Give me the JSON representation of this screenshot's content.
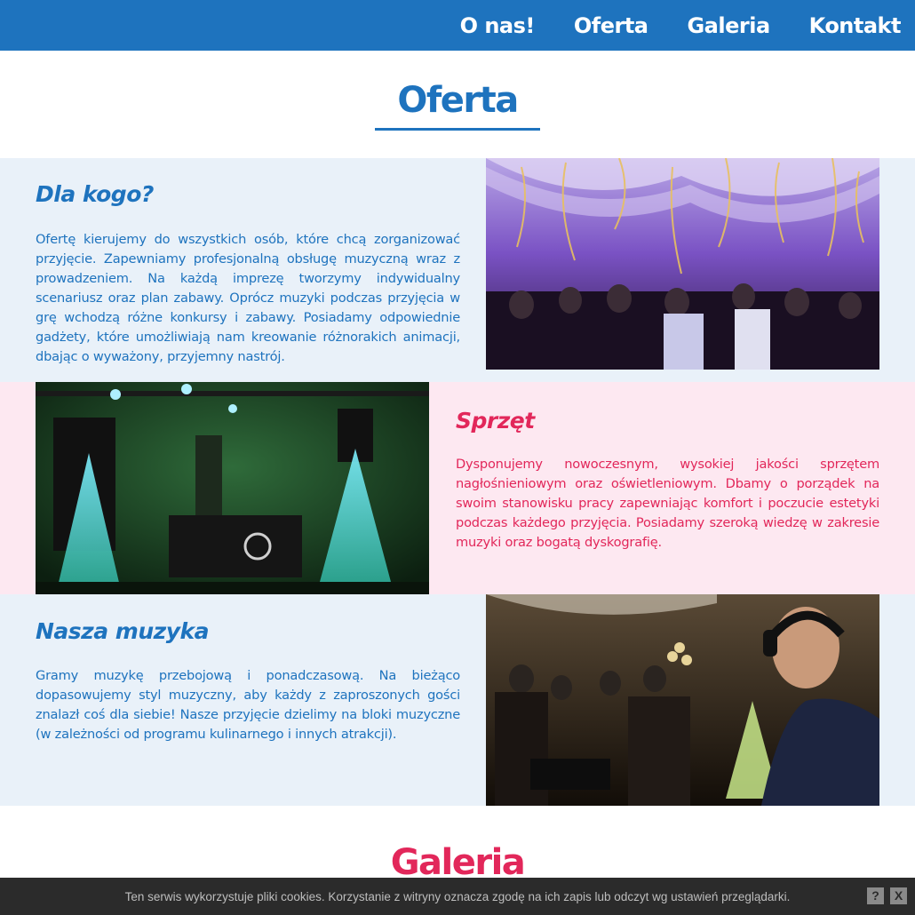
{
  "nav": {
    "items": [
      "O nas!",
      "Oferta",
      "Galeria",
      "Kontakt"
    ]
  },
  "oferta": {
    "title": "Oferta"
  },
  "sections": [
    {
      "title": "Dla kogo?",
      "text": "Ofertę kierujemy do wszystkich osób, które chcą zorganizować przyjęcie. Zapewniamy profesjonalną obsługę muzyczną wraz z prowadzeniem. Na każdą imprezę tworzymy indywidualny scenariusz oraz plan zabawy. Oprócz muzyki podczas przyjęcia w grę wchodzą różne konkursy i zabawy. Posiadamy odpowiednie gadżety, które umożliwiają nam kreowanie różnorakich animacji, dbając o wyważony, przyjemny nastrój."
    },
    {
      "title": "Sprzęt",
      "text": "Dysponujemy nowoczesnym, wysokiej jakości sprzętem nagłośnieniowym oraz oświetleniowym. Dbamy o porządek na swoim stanowisku pracy zapewniając komfort i poczucie estetyki podczas każdego przyjęcia. Posiadamy szeroką wiedzę w zakresie muzyki oraz bogatą dyskografię."
    },
    {
      "title": "Nasza muzyka",
      "text": "Gramy muzykę przebojową i ponadczasową. Na bieżąco dopasowujemy styl muzyczny, aby każdy z zaproszonych gości znalazł coś dla siebie! Nasze przyjęcie dzielimy na bloki muzyczne (w zależności od programu kulinarnego i innych atrakcji)."
    }
  ],
  "galeria": {
    "title": "Galeria"
  },
  "cookie": {
    "text": "Ten serwis wykorzystuje pliki cookies. Korzystanie z witryny oznacza zgodę na ich zapis lub odczyt wg ustawień przeglądarki.",
    "help_label": "?",
    "close_label": "X"
  },
  "colors": {
    "brand_blue": "#1e73be",
    "accent_pink": "#e2275a",
    "row_blue_bg": "#e9f1f9",
    "row_pink_bg": "#fde8f1"
  }
}
